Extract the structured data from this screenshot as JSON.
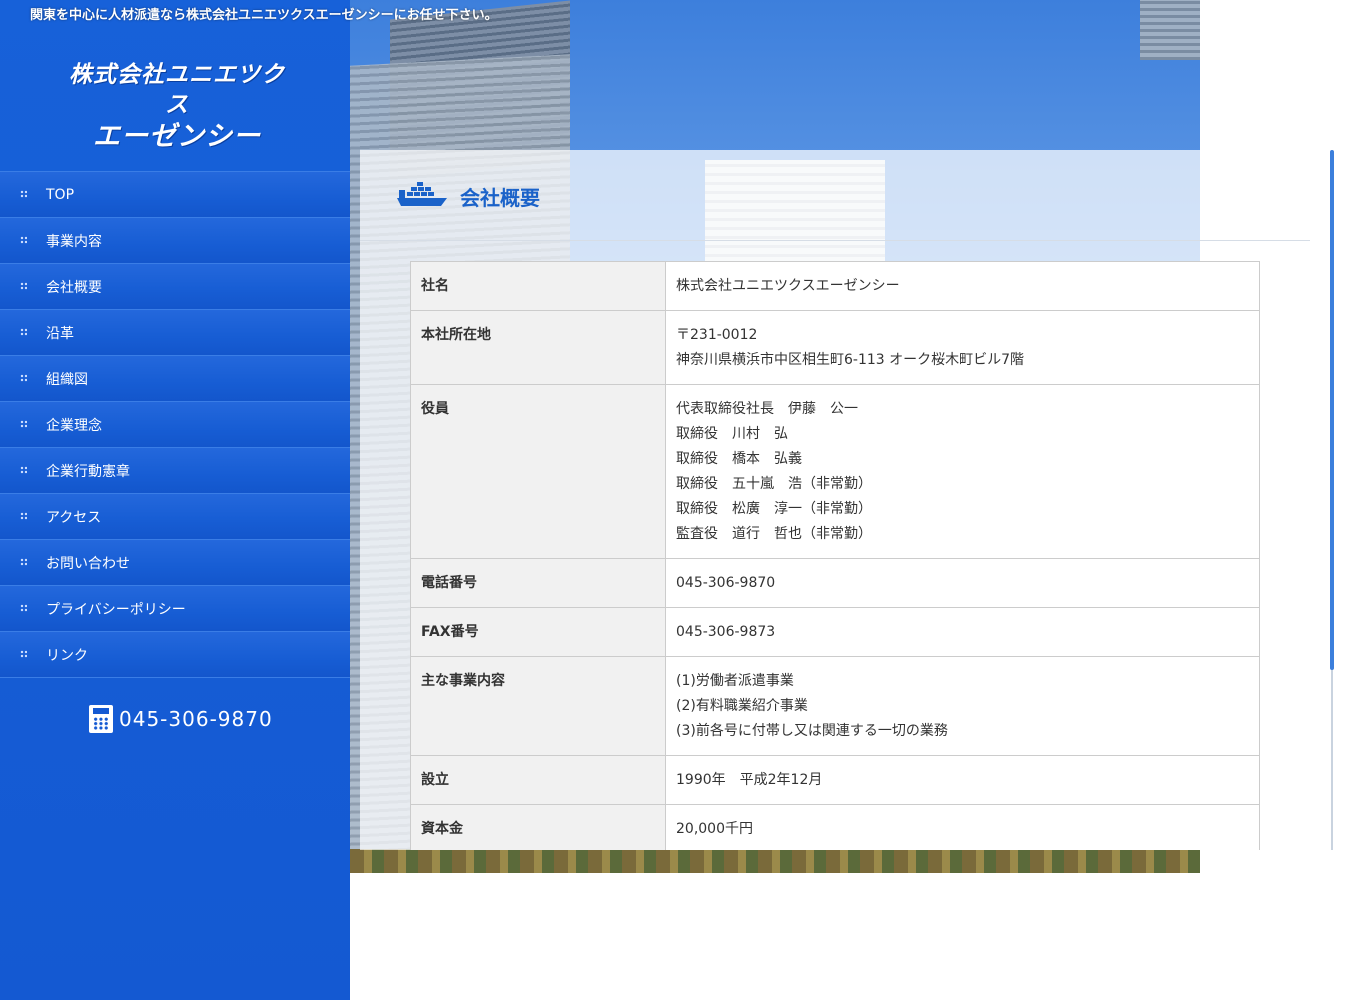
{
  "tagline": "関東を中心に人材派遣なら株式会社ユニエツクスエーゼンシーにお任せ下さい。",
  "logo": {
    "line1": "株式会社ユニエツクス",
    "line2": "エーゼンシー"
  },
  "nav": [
    {
      "label": "TOP"
    },
    {
      "label": "事業内容"
    },
    {
      "label": "会社概要"
    },
    {
      "label": "沿革"
    },
    {
      "label": "組織図"
    },
    {
      "label": "企業理念"
    },
    {
      "label": "企業行動憲章"
    },
    {
      "label": "アクセス"
    },
    {
      "label": "お問い合わせ"
    },
    {
      "label": "プライバシーポリシー"
    },
    {
      "label": "リンク"
    }
  ],
  "phone": {
    "icon": "phone-icon",
    "number": "045-306-9870"
  },
  "content": {
    "title": "会社概要",
    "title_icon": "ship-icon",
    "rows": [
      {
        "label": "社名",
        "lines": [
          "株式会社ユニエツクスエーゼンシー"
        ]
      },
      {
        "label": "本社所在地",
        "lines": [
          "〒231-0012",
          "神奈川県横浜市中区相生町6-113 オーク桜木町ビル7階"
        ]
      },
      {
        "label": "役員",
        "lines": [
          "代表取締役社長　伊藤　公一",
          "取締役　川村　弘",
          "取締役　橋本　弘義",
          "取締役　五十嵐　浩（非常勤）",
          "取締役　松廣　淳一（非常勤）",
          "監査役　道行　哲也（非常勤）"
        ]
      },
      {
        "label": "電話番号",
        "lines": [
          "045-306-9870"
        ]
      },
      {
        "label": "FAX番号",
        "lines": [
          "045-306-9873"
        ]
      },
      {
        "label": "主な事業内容",
        "lines": [
          "(1)労働者派遣事業",
          "(2)有料職業紹介事業",
          "(3)前各号に付帯し又は関連する一切の業務"
        ]
      },
      {
        "label": "設立",
        "lines": [
          "1990年　平成2年12月"
        ]
      },
      {
        "label": "資本金",
        "lines": [
          "20,000千円"
        ]
      }
    ]
  },
  "colors": {
    "sidebar": "#1459d2",
    "accent": "#1a62c9"
  }
}
